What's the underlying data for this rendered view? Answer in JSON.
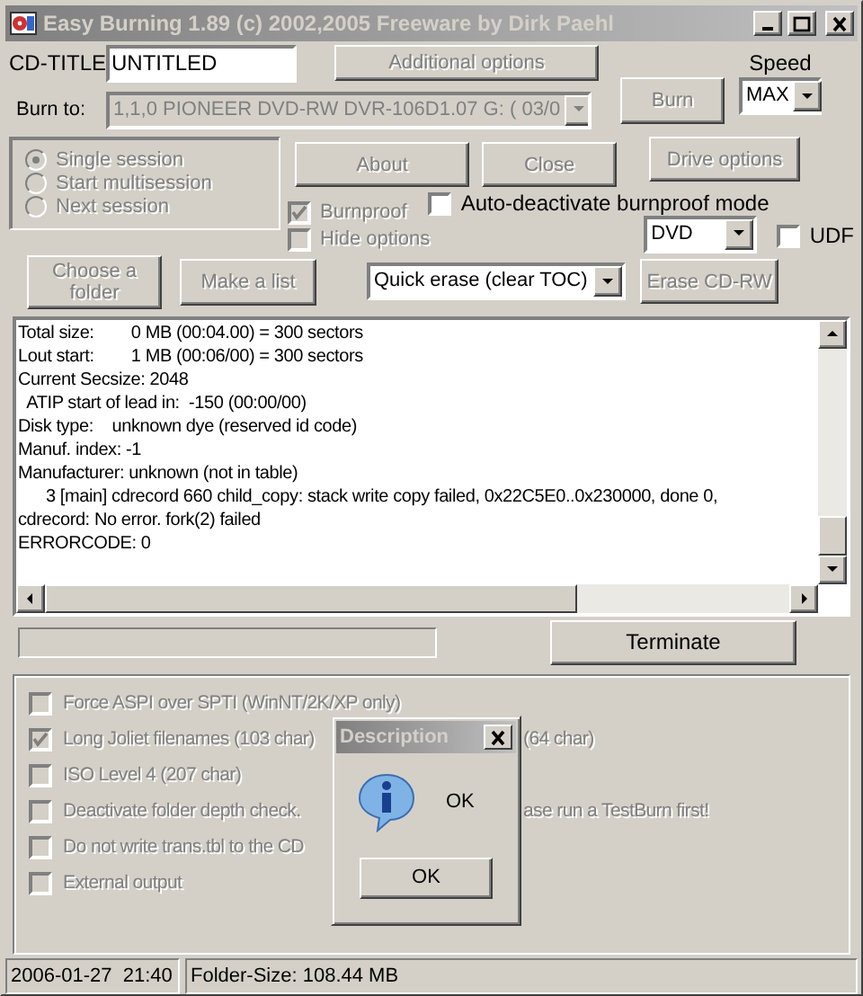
{
  "window": {
    "title": "Easy Burning 1.89 (c) 2002,2005 Freeware by Dirk Paehl",
    "active": false
  },
  "cd_title": {
    "label": "CD-TITLE",
    "value": "UNTITLED"
  },
  "additional_options": {
    "label": "Additional options",
    "disabled": true
  },
  "speed": {
    "label": "Speed",
    "value": "MAX"
  },
  "burn_to": {
    "label": "Burn to:",
    "value": "1,1,0 PIONEER DVD-RW  DVR-106D1.07 G: ( 03/0",
    "disabled": true
  },
  "burn_button": {
    "label": "Burn",
    "disabled": true
  },
  "sessions": [
    {
      "label": "Single session",
      "selected": true,
      "disabled": true
    },
    {
      "label": "Start multisession",
      "selected": false,
      "disabled": true
    },
    {
      "label": "Next session",
      "selected": false,
      "disabled": true
    }
  ],
  "about_button": {
    "label": "About",
    "disabled": true
  },
  "close_button": {
    "label": "Close",
    "disabled": true
  },
  "drive_options_button": {
    "label": "Drive options",
    "disabled": true
  },
  "burnproof": {
    "label": "Burnproof",
    "checked": true,
    "disabled": true
  },
  "auto_deactivate": {
    "label": "Auto-deactivate burnproof mode",
    "checked": false,
    "disabled": false
  },
  "hide_options": {
    "label": "Hide options",
    "checked": false,
    "disabled": true
  },
  "media": {
    "value": "DVD"
  },
  "udf": {
    "label": "UDF",
    "checked": false,
    "disabled": false
  },
  "choose_folder_button": {
    "label": "Choose a folder",
    "disabled": true
  },
  "make_list_button": {
    "label": "Make a list",
    "disabled": true
  },
  "erase_mode": {
    "value": "Quick erase (clear TOC)"
  },
  "erase_button": {
    "label": "Erase CD-RW",
    "disabled": true
  },
  "log": {
    "lines": [
      "Total size:        0 MB (00:04.00) = 300 sectors",
      "Lout start:        1 MB (00:06/00) = 300 sectors",
      "Current Secsize: 2048",
      "  ATIP start of lead in:  -150 (00:00/00)",
      "Disk type:    unknown dye (reserved id code)",
      "Manuf. index: -1",
      "Manufacturer: unknown (not in table)",
      "      3 [main] cdrecord 660 child_copy: stack write copy failed, 0x22C5E0..0x230000, done 0,",
      "cdrecord: No error. fork(2) failed",
      "ERRORCODE: 0"
    ]
  },
  "progress": {
    "level": 0
  },
  "terminate_button": {
    "label": "Terminate",
    "disabled": false
  },
  "options": [
    {
      "label": "Force ASPI over SPTI (WinNT/2K/XP only)",
      "checked": false,
      "disabled": true
    },
    {
      "label": "Long Joliet filenames (103 char)",
      "label_after": "(64 char)",
      "checked": true,
      "disabled": true
    },
    {
      "label": "ISO Level 4 (207 char)",
      "checked": false,
      "disabled": true
    },
    {
      "label": "Deactivate folder depth check.",
      "label_after": "ase run a TestBurn first!",
      "checked": false,
      "disabled": true
    },
    {
      "label": "Do not write trans.tbl to the CD",
      "checked": false,
      "disabled": true
    },
    {
      "label": "External output",
      "checked": false,
      "disabled": true
    }
  ],
  "dialog": {
    "title": "Description",
    "message": "OK",
    "button": "OK"
  },
  "status_bar": [
    "2006-01-27  21:40",
    "Folder-Size: 108.44 MB"
  ]
}
